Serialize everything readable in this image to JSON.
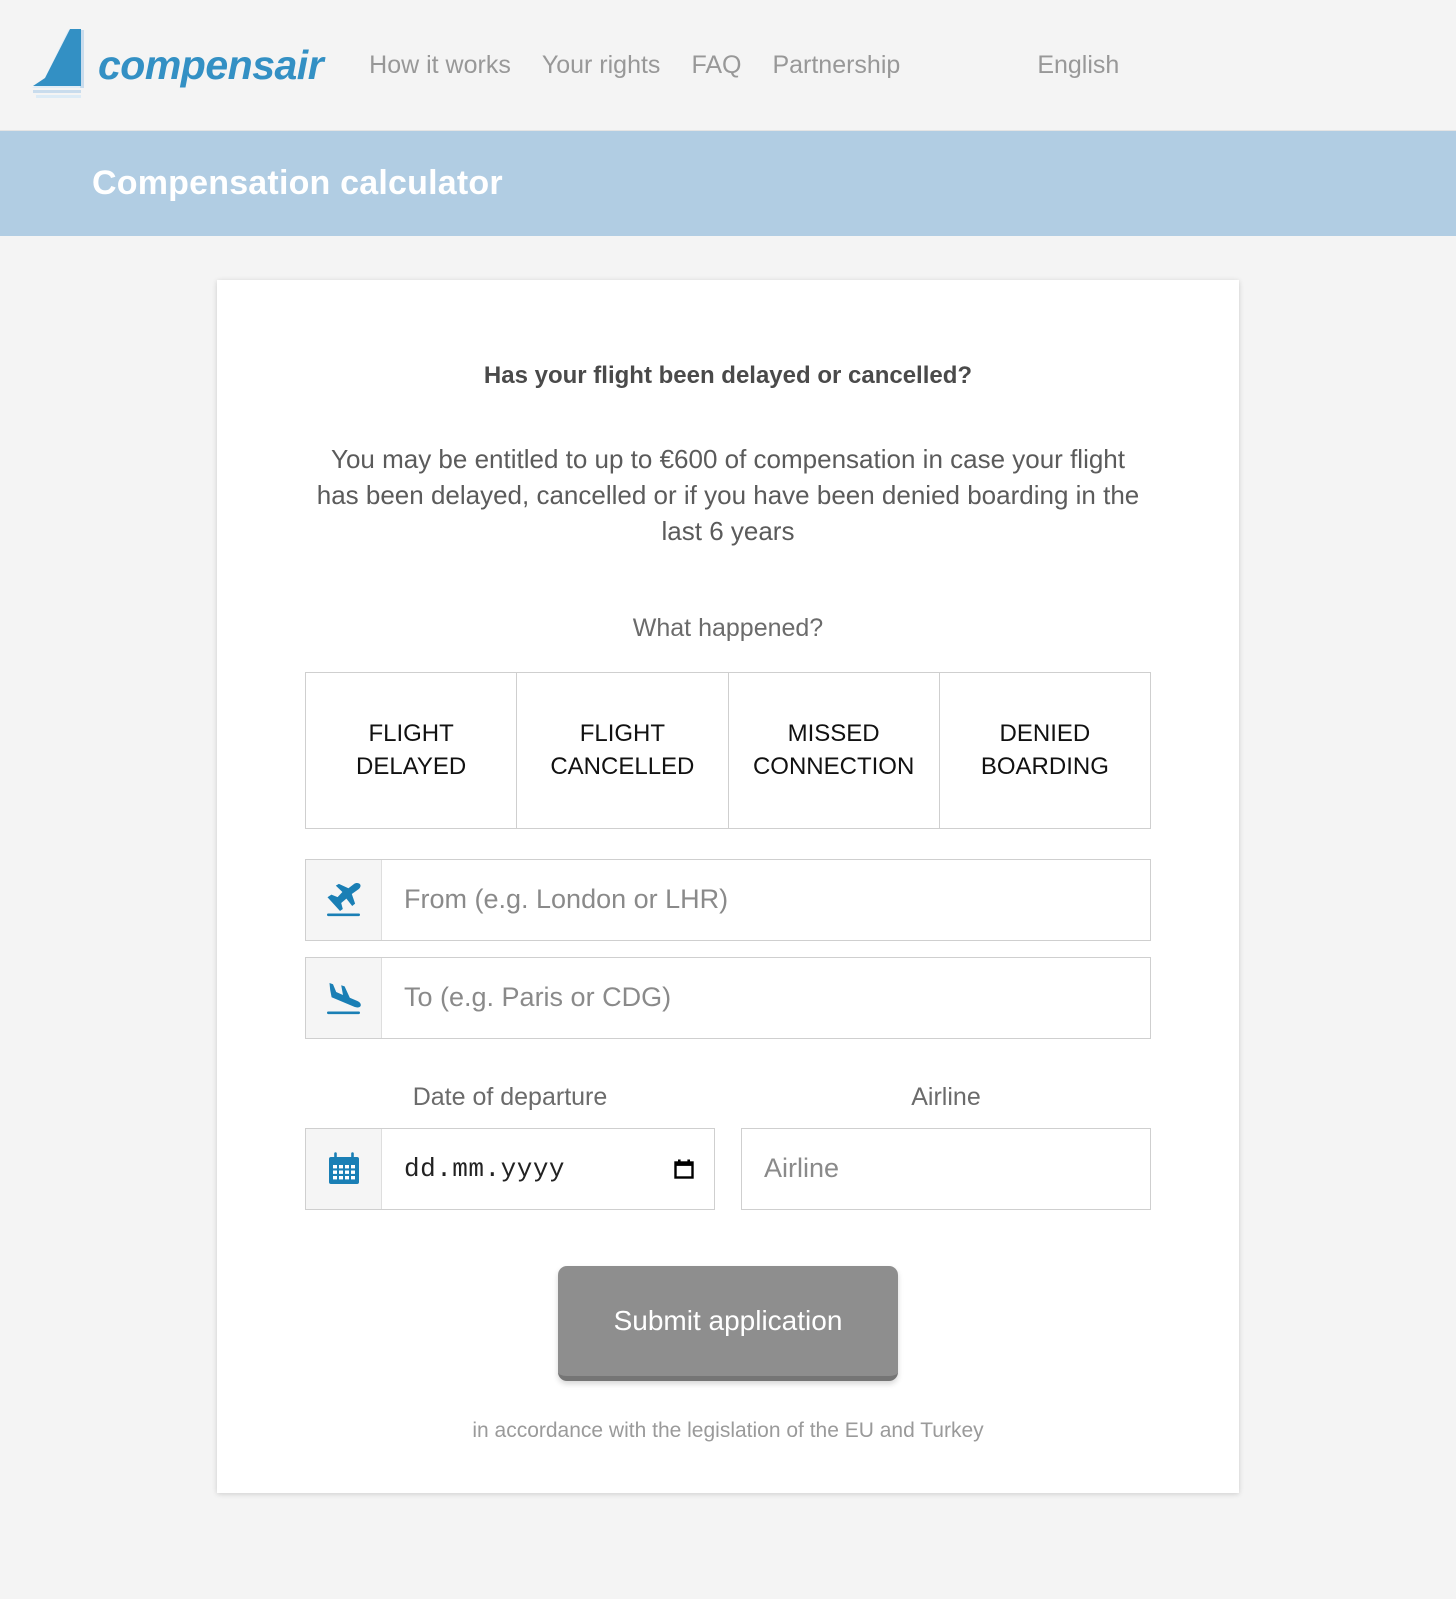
{
  "header": {
    "brand_name": "compensair",
    "brand_logo_icon": "airplane-tail-fin-logo",
    "nav": [
      {
        "label": "How it works"
      },
      {
        "label": "Your rights"
      },
      {
        "label": "FAQ"
      },
      {
        "label": "Partnership"
      }
    ],
    "language": "English"
  },
  "banner": {
    "title": "Compensation calculator"
  },
  "calculator": {
    "heading": "Has your flight been delayed or cancelled?",
    "intro": "You may be entitled to up to €600 of compensation in case your flight has been delayed, cancelled or if you have been denied boarding in the last 6 years",
    "question_label": "What happened?",
    "options": [
      {
        "line1": "FLIGHT",
        "line2": "DELAYED"
      },
      {
        "line1": "FLIGHT",
        "line2": "CANCELLED"
      },
      {
        "line1": "MISSED",
        "line2": "CONNECTION"
      },
      {
        "line1": "DENIED",
        "line2": "BOARDING"
      }
    ],
    "from_field": {
      "icon": "airplane-takeoff-icon",
      "placeholder": "From (e.g. London or LHR)",
      "value": ""
    },
    "to_field": {
      "icon": "airplane-landing-icon",
      "placeholder": "To (e.g. Paris or CDG)",
      "value": ""
    },
    "date_field": {
      "icon": "calendar-icon",
      "label": "Date of departure",
      "placeholder": "dd.mm.yyyy",
      "value": "",
      "picker_icon": "calendar-picker-icon"
    },
    "airline_field": {
      "label": "Airline",
      "placeholder": "Airline",
      "value": ""
    },
    "submit_label": "Submit application",
    "legal_note": "in accordance with the legislation of the EU and Turkey"
  },
  "colors": {
    "brand_blue": "#3390c4",
    "banner_blue": "#b1cde3",
    "icon_blue": "#1a7fb5",
    "page_bg": "#f4f4f4",
    "submit_gray": "#8e8e8e"
  }
}
